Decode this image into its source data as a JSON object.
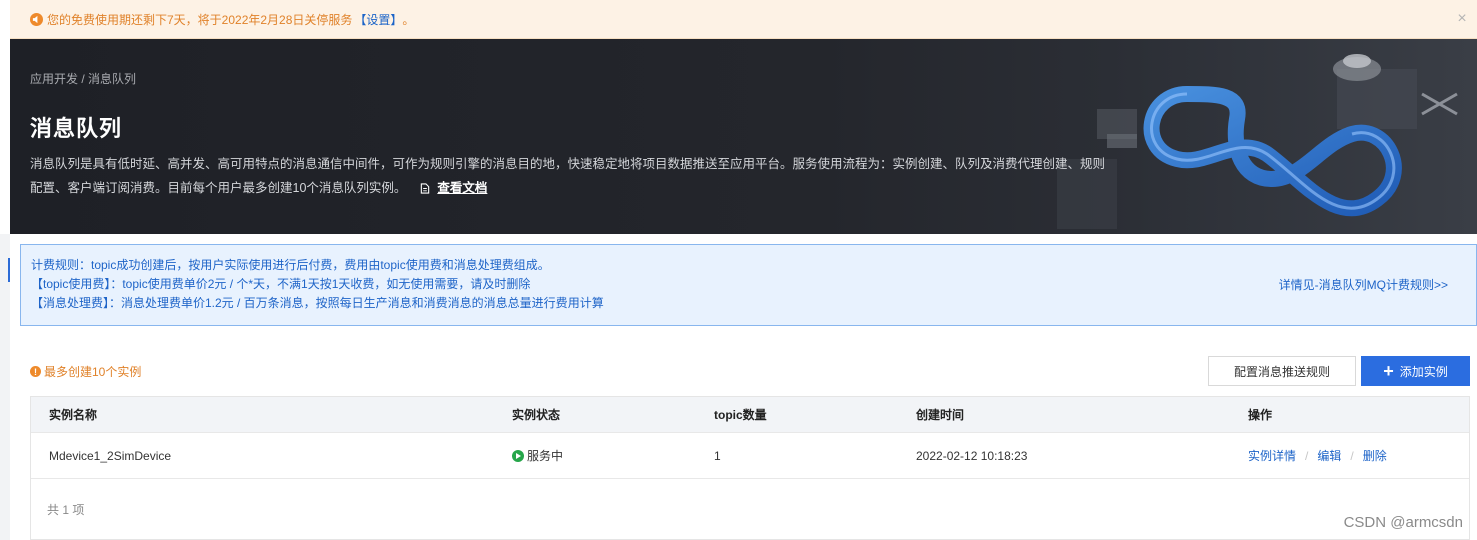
{
  "notice": {
    "text": "您的免费使用期还剩下7天，将于2022年2月28日关停服务",
    "link": "【设置】",
    "suffix": "。",
    "close": "×"
  },
  "banner": {
    "breadcrumb": "应用开发 / 消息队列",
    "title": "消息队列",
    "description": "消息队列是具有低时延、高并发、高可用特点的消息通信中间件，可作为规则引擎的消息目的地，快速稳定地将项目数据推送至应用平台。服务使用流程为：实例创建、队列及消费代理创建、规则配置、客户端订阅消费。目前每个用户最多创建10个消息队列实例。",
    "doc_link": "查看文档"
  },
  "billing": {
    "line1": "计费规则：topic成功创建后，按用户实际使用进行后付费，费用由topic使用费和消息处理费组成。",
    "line2": "【topic使用费】：topic使用费单价2元 / 个*天，不满1天按1天收费，如无使用需要，请及时删除",
    "line3": "【消息处理费】：消息处理费单价1.2元 / 百万条消息，按照每日生产消息和消费消息的消息总量进行费用计算",
    "more_link": "详情见-消息队列MQ计费规则>>"
  },
  "toolbar": {
    "limit_text": "最多创建10个实例",
    "limit_icon": "!",
    "config_button": "配置消息推送规则",
    "add_button": "添加实例",
    "add_icon": "+"
  },
  "table": {
    "columns": [
      "实例名称",
      "实例状态",
      "topic数量",
      "创建时间",
      "操作"
    ],
    "rows": [
      {
        "name": "Mdevice1_2SimDevice",
        "status": "服务中",
        "topic_count": "1",
        "created": "2022-02-12 10:18:23",
        "ops": [
          "实例详情",
          "编辑",
          "删除"
        ]
      }
    ],
    "separator": "/",
    "footer": "共 1 项"
  },
  "watermark": "CSDN @armcsdn",
  "colors": {
    "accent": "#2b6de0",
    "warning": "#e0822a",
    "status_running": "#26a64a",
    "banner_bg": "#1e2026"
  }
}
